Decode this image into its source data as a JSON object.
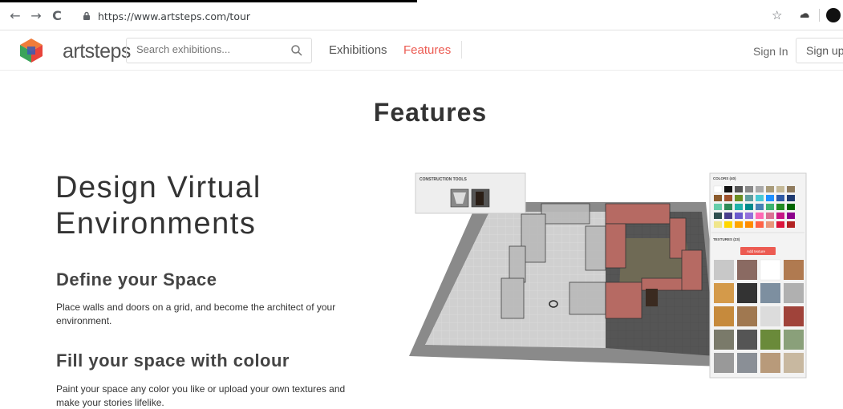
{
  "browser": {
    "url": "https://www.artsteps.com/tour",
    "back_icon": "arrow-left-icon",
    "forward_icon": "arrow-right-icon",
    "reload_icon": "reload-icon",
    "back_glyph": "←",
    "forward_glyph": "→",
    "reload_glyph": "C",
    "star_glyph": "☆"
  },
  "header": {
    "logo_text": "artsteps",
    "search_placeholder": "Search exhibitions...",
    "nav": [
      {
        "label": "Exhibitions",
        "active": false
      },
      {
        "label": "Features",
        "active": true
      }
    ],
    "sign_in": "Sign In",
    "sign_up": "Sign up",
    "accent_color": "#ec5b52"
  },
  "main": {
    "title": "Features",
    "hero_heading": "Design Virtual Environments",
    "sections": [
      {
        "heading": "Define your Space",
        "text": "Place walls and doors on a grid, and become the architect of your environment."
      },
      {
        "heading": "Fill your space with colour",
        "text": "Paint your space any color you like or upload your own textures and make your stories lifelike."
      }
    ]
  },
  "illustration": {
    "construction_tools_label": "CONSTRUCTION TOOLS",
    "colors_label": "COLORS (40)",
    "textures_label": "TEXTURES (23)",
    "add_texture_label": "Add texture"
  }
}
